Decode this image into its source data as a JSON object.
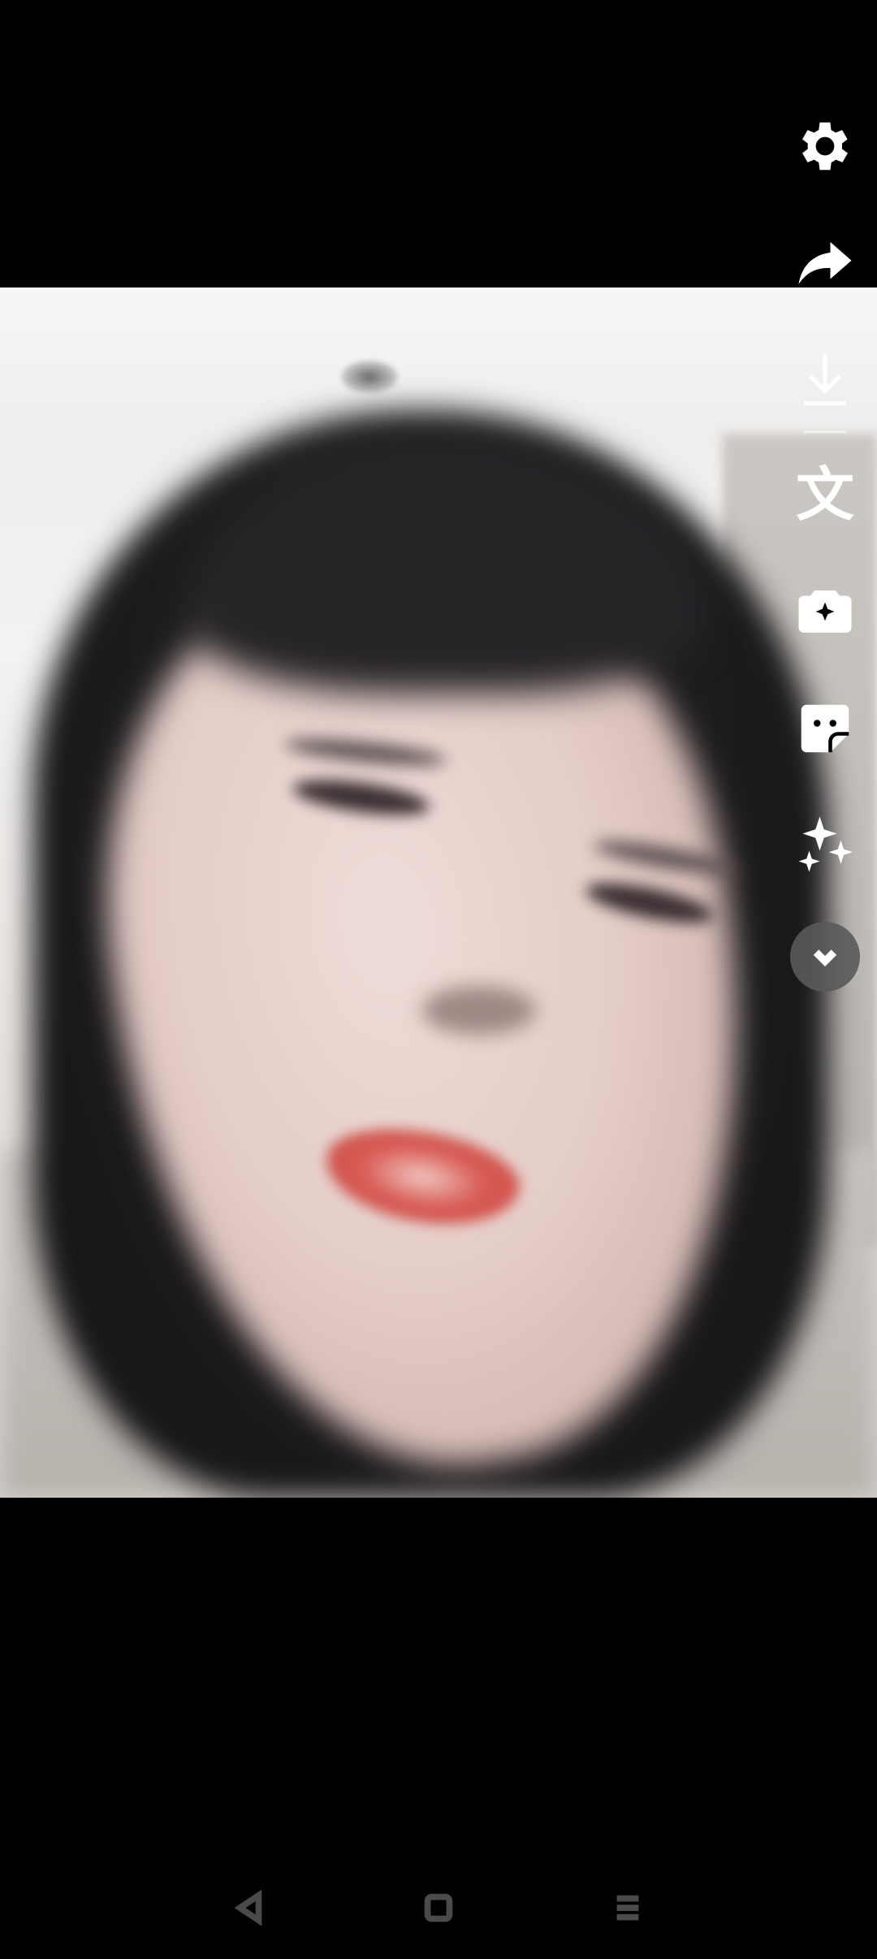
{
  "toolbar": {
    "items": [
      {
        "name": "settings",
        "icon": "gear-icon"
      },
      {
        "name": "share",
        "icon": "share-arrow-icon"
      },
      {
        "name": "download",
        "icon": "download-icon"
      },
      {
        "name": "translate",
        "icon": "translate-icon",
        "glyph": "文"
      },
      {
        "name": "lens",
        "icon": "lens-sparkle-icon"
      },
      {
        "name": "sticker",
        "icon": "sticker-icon"
      },
      {
        "name": "ai-effects",
        "icon": "sparkles-icon"
      },
      {
        "name": "more",
        "icon": "chevron-down-icon"
      }
    ]
  },
  "navbar": {
    "items": [
      {
        "name": "back",
        "icon": "back-triangle-icon"
      },
      {
        "name": "home",
        "icon": "home-square-icon"
      },
      {
        "name": "recents",
        "icon": "menu-lines-icon"
      }
    ]
  },
  "colors": {
    "background": "#000000",
    "icon": "#ffffff",
    "more_button_bg": "#5a5a5a",
    "nav_icon": "#4a4a4a"
  }
}
